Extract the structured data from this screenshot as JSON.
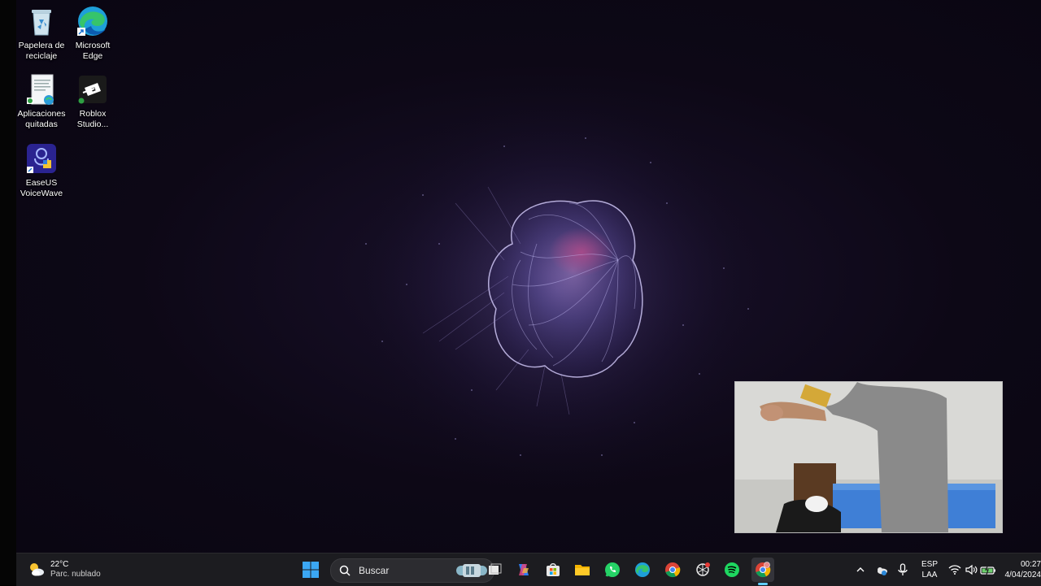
{
  "desktop_icons": [
    {
      "label": "Papelera de\nreciclaje",
      "icon": "recycle-bin-icon"
    },
    {
      "label": "Microsoft\nEdge",
      "icon": "edge-icon"
    },
    {
      "label": "Aplicaciones\nquitadas",
      "icon": "document-icon"
    },
    {
      "label": "Roblox\nStudio...",
      "icon": "roblox-studio-icon"
    },
    {
      "label": "EaseUS\nVoiceWave",
      "icon": "easeus-voicewave-icon"
    }
  ],
  "taskbar": {
    "weather": {
      "temp": "22°C",
      "condition": "Parc. nublado",
      "icon": "partly-cloudy-icon"
    },
    "search_label": "Buscar",
    "apps": [
      "start-icon",
      "search-icon",
      "task-view-icon",
      "copilot-icon",
      "store-icon",
      "file-explorer-icon",
      "whatsapp-icon",
      "edge-icon",
      "chrome-icon",
      "openai-icon",
      "spotify-icon",
      "chrome-active-icon"
    ],
    "tray": {
      "language_line1": "ESP",
      "language_line2": "LAA",
      "time": "00:27",
      "date": "4/04/2024"
    }
  },
  "colors": {
    "taskbar_bg": "#1c1c20",
    "wallpaper_bg": "#0d0816",
    "accent": "#a89cf0"
  }
}
